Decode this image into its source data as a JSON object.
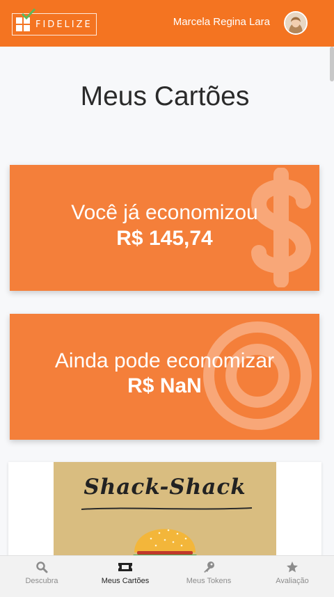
{
  "header": {
    "logo_text": "FIDELIZE",
    "user_name": "Marcela Regina Lara",
    "brand_color": "#f47421"
  },
  "page": {
    "title": "Meus Cartões"
  },
  "stats": {
    "saved": {
      "label": "Você já economizou",
      "value": "R$ 145,74",
      "icon": "dollar-sign-icon"
    },
    "potential": {
      "label": "Ainda pode economizar",
      "value": "R$ NaN",
      "icon": "target-icon"
    }
  },
  "store_card": {
    "name": "Shack-Shack",
    "icon": "burger-image"
  },
  "bottom_nav": {
    "items": [
      {
        "label": "Descubra",
        "icon": "search-icon",
        "active": false
      },
      {
        "label": "Meus Cartões",
        "icon": "ticket-icon",
        "active": true
      },
      {
        "label": "Meus Tokens",
        "icon": "key-icon",
        "active": false
      },
      {
        "label": "Avaliação",
        "icon": "star-icon",
        "active": false
      }
    ]
  }
}
